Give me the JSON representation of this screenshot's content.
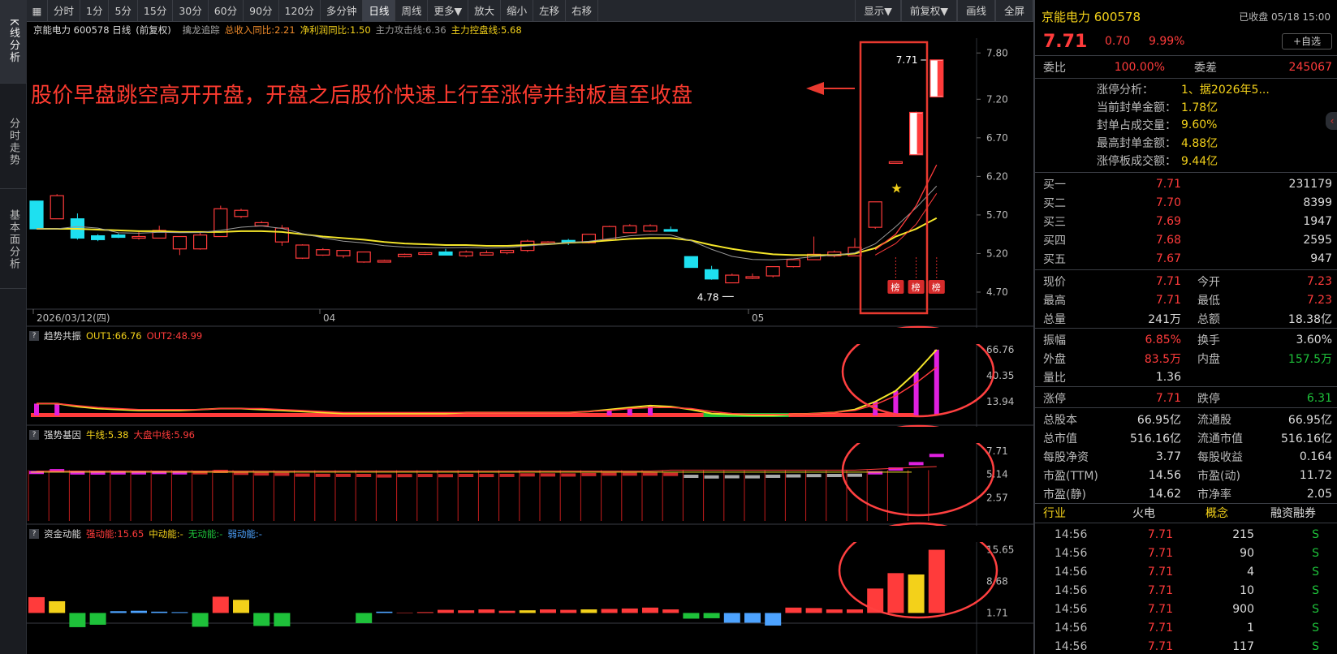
{
  "left_tabs": [
    {
      "label": "K线分析"
    },
    {
      "label": "分时走势"
    },
    {
      "label": "基本面分析"
    }
  ],
  "toolbar": {
    "periods": [
      "分时",
      "1分",
      "5分",
      "15分",
      "30分",
      "60分",
      "90分",
      "120分",
      "多分钟",
      "日线",
      "周线",
      "更多▼"
    ],
    "active": "日线",
    "actions": [
      "放大",
      "缩小",
      "左移",
      "右移"
    ],
    "right": [
      "显示▼",
      "前复权▼",
      "画线",
      "全屏"
    ]
  },
  "main_panel": {
    "header": {
      "stock": "京能电力 600578 日线",
      "adjust": "(前复权)",
      "indicator": "擒龙追踪",
      "metric1": "总收入同比:2.21",
      "metric2": "净利润同比:1.50",
      "metric3": "主力攻击线:6.36",
      "metric4": "主力控盘线:5.68"
    },
    "annotation": "股价早盘跳空高开开盘，开盘之后股价快速上行至涨停并封板直至收盘",
    "high_label": "7.71",
    "low_label": "4.78",
    "date_labels": [
      "2026/03/12(四)",
      "04",
      "05"
    ],
    "bang_label": "榜",
    "y_ticks": [
      "7.80",
      "7.20",
      "6.70",
      "6.20",
      "5.70",
      "5.20",
      "4.70"
    ]
  },
  "panel2": {
    "name": "趋势共振",
    "out1": "OUT1:66.76",
    "out2": "OUT2:48.99",
    "y_ticks": [
      "66.76",
      "40.35",
      "13.94"
    ]
  },
  "panel3": {
    "name": "强势基因",
    "l1": "牛线:5.38",
    "l2": "大盘中线:5.96",
    "y_ticks": [
      "7.71",
      "5.14",
      "2.57"
    ]
  },
  "panel4": {
    "name": "资金动能",
    "l1": "强动能:15.65",
    "l2": "中动能:-",
    "l3": "无动能:-",
    "l4": "弱动能:-",
    "y_ticks": [
      "15.65",
      "8.68",
      "1.71"
    ]
  },
  "chart_data": [
    {
      "type": "candlestick",
      "title": "京能电力 600578 日线",
      "ylim": [
        4.5,
        7.95
      ],
      "series": [
        {
          "name": "K",
          "ohlc": [
            [
              5.88,
              5.88,
              5.52,
              5.52
            ],
            [
              5.65,
              5.97,
              5.65,
              5.95
            ],
            [
              5.65,
              5.72,
              5.38,
              5.4
            ],
            [
              5.43,
              5.45,
              5.36,
              5.38
            ],
            [
              5.44,
              5.46,
              5.4,
              5.41
            ],
            [
              5.41,
              5.48,
              5.38,
              5.42
            ],
            [
              5.4,
              5.56,
              5.4,
              5.5
            ],
            [
              5.26,
              5.42,
              5.18,
              5.42
            ],
            [
              5.26,
              5.48,
              5.25,
              5.44
            ],
            [
              5.42,
              5.82,
              5.42,
              5.78
            ],
            [
              5.68,
              5.78,
              5.66,
              5.76
            ],
            [
              5.56,
              5.62,
              5.56,
              5.6
            ],
            [
              5.35,
              5.57,
              5.3,
              5.53
            ],
            [
              5.14,
              5.32,
              5.13,
              5.31
            ],
            [
              5.18,
              5.27,
              5.17,
              5.25
            ],
            [
              5.17,
              5.24,
              5.14,
              5.24
            ],
            [
              5.09,
              5.22,
              5.08,
              5.22
            ],
            [
              5.1,
              5.12,
              5.09,
              5.11
            ],
            [
              5.16,
              5.2,
              5.15,
              5.19
            ],
            [
              5.19,
              5.22,
              5.18,
              5.21
            ],
            [
              5.22,
              5.26,
              5.18,
              5.18
            ],
            [
              5.17,
              5.24,
              5.15,
              5.22
            ],
            [
              5.18,
              5.24,
              5.18,
              5.21
            ],
            [
              5.21,
              5.24,
              5.19,
              5.24
            ],
            [
              5.24,
              5.38,
              5.22,
              5.36
            ],
            [
              5.33,
              5.36,
              5.32,
              5.35
            ],
            [
              5.37,
              5.39,
              5.31,
              5.34
            ],
            [
              5.34,
              5.45,
              5.33,
              5.45
            ],
            [
              5.38,
              5.56,
              5.38,
              5.55
            ],
            [
              5.47,
              5.58,
              5.47,
              5.56
            ],
            [
              5.49,
              5.58,
              5.48,
              5.56
            ],
            [
              5.51,
              5.55,
              5.49,
              5.49
            ],
            [
              5.16,
              5.16,
              5.02,
              5.02
            ],
            [
              4.99,
              5.04,
              4.86,
              4.87
            ],
            [
              4.82,
              4.94,
              4.82,
              4.92
            ],
            [
              4.89,
              4.94,
              4.87,
              4.9
            ],
            [
              4.91,
              5.03,
              4.89,
              5.03
            ],
            [
              5.03,
              5.13,
              5.02,
              5.12
            ],
            [
              5.12,
              5.42,
              5.12,
              5.19
            ],
            [
              5.17,
              5.24,
              5.15,
              5.22
            ],
            [
              5.17,
              5.4,
              5.17,
              5.28
            ],
            [
              5.54,
              5.87,
              5.52,
              5.87
            ],
            [
              6.39,
              6.39,
              6.39,
              6.39
            ],
            [
              6.48,
              7.04,
              6.48,
              7.03
            ],
            [
              7.23,
              7.71,
              7.23,
              7.71
            ]
          ]
        },
        {
          "name": "MA(yellow)",
          "values": [
            5.52,
            5.52,
            5.52,
            5.51,
            5.5,
            5.49,
            5.49,
            5.48,
            5.48,
            5.48,
            5.49,
            5.49,
            5.48,
            5.45,
            5.42,
            5.4,
            5.38,
            5.35,
            5.33,
            5.32,
            5.31,
            5.31,
            5.3,
            5.3,
            5.31,
            5.32,
            5.34,
            5.35,
            5.37,
            5.39,
            5.4,
            5.4,
            5.37,
            5.31,
            5.26,
            5.22,
            5.19,
            5.18,
            5.18,
            5.18,
            5.2,
            5.27,
            5.42,
            5.52,
            5.66
          ]
        }
      ]
    },
    {
      "type": "line",
      "title": "趋势共振",
      "ylim": [
        0,
        70
      ],
      "series": [
        {
          "name": "OUT1",
          "values": [
            12,
            12,
            9,
            7,
            6,
            5,
            5,
            5,
            6,
            7,
            7,
            6,
            5,
            4,
            3,
            2,
            2,
            2,
            2,
            2,
            2,
            3,
            3,
            3,
            3,
            3,
            3,
            4,
            6,
            8,
            10,
            9,
            6,
            2,
            1,
            0,
            0,
            1,
            2,
            3,
            6,
            14,
            25,
            44,
            66.76
          ]
        },
        {
          "name": "OUT2",
          "values": [
            12,
            12,
            10,
            8,
            7,
            6,
            6,
            6,
            6,
            7,
            7,
            7,
            6,
            5,
            4,
            3,
            3,
            3,
            3,
            3,
            3,
            3,
            3,
            3,
            3,
            3,
            3,
            4,
            5,
            7,
            8,
            8,
            7,
            4,
            2,
            1,
            1,
            1,
            2,
            3,
            5,
            11,
            20,
            33,
            48.99
          ]
        }
      ]
    },
    {
      "type": "bar",
      "title": "强势基因",
      "ylim": [
        0,
        8.5
      ],
      "series": [
        {
          "name": "牛线",
          "values": [
            5.38
          ]
        },
        {
          "name": "大盘中线",
          "values": [
            5.96
          ]
        }
      ]
    },
    {
      "type": "bar",
      "title": "资金动能",
      "ylim": [
        0,
        17
      ],
      "series": [
        {
          "name": "强动能",
          "values": [
            5.2,
            4.3,
            2.7,
            2.1,
            2.1,
            2.2,
            2.0,
            1.9,
            2.6,
            5.3,
            4.6,
            2.4,
            2.5,
            0.7,
            1.7,
            1.7,
            1.7,
            2.0,
            1.8,
            1.9,
            2.4,
            2.3,
            2.5,
            2.2,
            2.3,
            2.5,
            2.4,
            2.5,
            2.6,
            2.7,
            2.9,
            2.5,
            0.6,
            0.5,
            1.6,
            1.6,
            2.3,
            2.9,
            2.8,
            2.5,
            2.5,
            7.1,
            10.5,
            10.2,
            15.65
          ]
        }
      ]
    }
  ],
  "quote": {
    "title": "京能电力 600578",
    "status": "已收盘 05/18 15:00",
    "price": "7.71",
    "change": "0.70",
    "pct": "9.99%",
    "watch_btn": "+自选",
    "weibi_label": "委比",
    "weibi": "100.00%",
    "weicha_label": "委差",
    "weicha": "245067",
    "analysis": [
      {
        "k": "涨停分析：",
        "v": "1、据2026年5..."
      },
      {
        "k": "当前封单金额：",
        "v": "1.78亿"
      },
      {
        "k": "封单占成交量：",
        "v": "9.60%"
      },
      {
        "k": "最高封单金额：",
        "v": "4.88亿"
      },
      {
        "k": "涨停板成交额：",
        "v": "9.44亿"
      }
    ],
    "bids": [
      {
        "k": "买一",
        "p": "7.71",
        "v": "231179"
      },
      {
        "k": "买二",
        "p": "7.70",
        "v": "8399"
      },
      {
        "k": "买三",
        "p": "7.69",
        "v": "1947"
      },
      {
        "k": "买四",
        "p": "7.68",
        "v": "2595"
      },
      {
        "k": "买五",
        "p": "7.67",
        "v": "947"
      }
    ],
    "stats1": [
      {
        "k1": "现价",
        "v1": "7.71",
        "c1": "red",
        "k2": "今开",
        "v2": "7.23",
        "c2": "red"
      },
      {
        "k1": "最高",
        "v1": "7.71",
        "c1": "red",
        "k2": "最低",
        "v2": "7.23",
        "c2": "red"
      },
      {
        "k1": "总量",
        "v1": "241万",
        "c1": "white",
        "k2": "总额",
        "v2": "18.38亿",
        "c2": "white"
      }
    ],
    "stats2": [
      {
        "k1": "振幅",
        "v1": "6.85%",
        "c1": "red",
        "k2": "换手",
        "v2": "3.60%",
        "c2": "white"
      },
      {
        "k1": "外盘",
        "v1": "83.5万",
        "c1": "red",
        "k2": "内盘",
        "v2": "157.5万",
        "c2": "green"
      },
      {
        "k1": "量比",
        "v1": "1.36",
        "c1": "white",
        "k2": "",
        "v2": "",
        "c2": "white"
      }
    ],
    "stats3": [
      {
        "k1": "涨停",
        "v1": "7.71",
        "c1": "red",
        "k2": "跌停",
        "v2": "6.31",
        "c2": "green"
      }
    ],
    "stats4": [
      {
        "k1": "总股本",
        "v1": "66.95亿",
        "k2": "流通股",
        "v2": "66.95亿"
      },
      {
        "k1": "总市值",
        "v1": "516.16亿",
        "k2": "流通市值",
        "v2": "516.16亿"
      },
      {
        "k1": "每股净资",
        "v1": "3.77",
        "k2": "每股收益",
        "v2": "0.164"
      },
      {
        "k1": "市盈(TTM)",
        "v1": "14.56",
        "k2": "市盈(动)",
        "v2": "11.72"
      },
      {
        "k1": "市盈(静)",
        "v1": "14.62",
        "k2": "市净率",
        "v2": "2.05"
      }
    ],
    "tabs": [
      "行业",
      "火电",
      "概念",
      "融资融券"
    ],
    "ticks": [
      {
        "t": "14:56",
        "p": "7.71",
        "v": "215",
        "s": "S"
      },
      {
        "t": "14:56",
        "p": "7.71",
        "v": "90",
        "s": "S"
      },
      {
        "t": "14:56",
        "p": "7.71",
        "v": "4",
        "s": "S"
      },
      {
        "t": "14:56",
        "p": "7.71",
        "v": "10",
        "s": "S"
      },
      {
        "t": "14:56",
        "p": "7.71",
        "v": "900",
        "s": "S"
      },
      {
        "t": "14:56",
        "p": "7.71",
        "v": "1",
        "s": "S"
      },
      {
        "t": "14:56",
        "p": "7.71",
        "v": "117",
        "s": "S"
      }
    ]
  },
  "colors": {
    "up": "#ff3b3b",
    "down": "#1ee0f0",
    "ma": "#f5e62a",
    "ma2": "#9a9a9a",
    "highlight": "#e8392f",
    "green": "#1ec13a"
  }
}
